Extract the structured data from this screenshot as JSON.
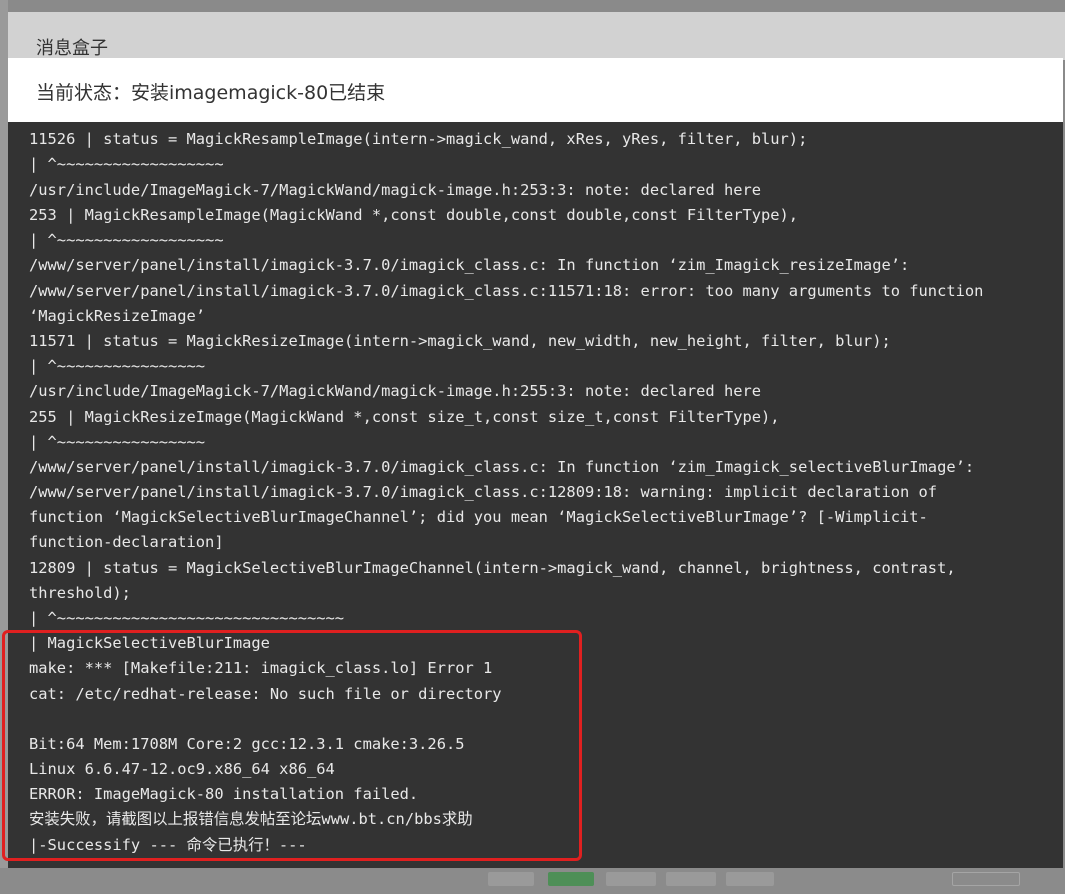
{
  "dialog": {
    "title": "消息盒子",
    "status": "当前状态：安装imagemagick-80已结束"
  },
  "log": {
    "lines": [
      "11526 | status = MagickResampleImage(intern->magick_wand, xRes, yRes, filter, blur);",
      "| ^~~~~~~~~~~~~~~~~~~",
      "/usr/include/ImageMagick-7/MagickWand/magick-image.h:253:3: note: declared here",
      "253 | MagickResampleImage(MagickWand *,const double,const double,const FilterType),",
      "| ^~~~~~~~~~~~~~~~~~~",
      "/www/server/panel/install/imagick-3.7.0/imagick_class.c: In function ‘zim_Imagick_resizeImage’:",
      "/www/server/panel/install/imagick-3.7.0/imagick_class.c:11571:18: error: too many arguments to function",
      "‘MagickResizeImage’",
      "11571 | status = MagickResizeImage(intern->magick_wand, new_width, new_height, filter, blur);",
      "| ^~~~~~~~~~~~~~~~~",
      "/usr/include/ImageMagick-7/MagickWand/magick-image.h:255:3: note: declared here",
      "255 | MagickResizeImage(MagickWand *,const size_t,const size_t,const FilterType),",
      "| ^~~~~~~~~~~~~~~~~",
      "/www/server/panel/install/imagick-3.7.0/imagick_class.c: In function ‘zim_Imagick_selectiveBlurImage’:",
      "/www/server/panel/install/imagick-3.7.0/imagick_class.c:12809:18: warning: implicit declaration of",
      "function ‘MagickSelectiveBlurImageChannel’; did you mean ‘MagickSelectiveBlurImage’? [-Wimplicit-",
      "function-declaration]",
      "12809 | status = MagickSelectiveBlurImageChannel(intern->magick_wand, channel, brightness, contrast,",
      "threshold);",
      "| ^~~~~~~~~~~~~~~~~~~~~~~~~~~~~~~~",
      "| MagickSelectiveBlurImage",
      "make: *** [Makefile:211: imagick_class.lo] Error 1",
      "cat: /etc/redhat-release: No such file or directory",
      "",
      "Bit:64 Mem:1708M Core:2 gcc:12.3.1 cmake:3.26.5",
      "Linux 6.6.47-12.oc9.x86_64 x86_64",
      "ERROR: ImageMagick-80 installation failed.",
      "安装失败，请截图以上报错信息发帖至论坛www.bt.cn/bbs求助",
      "|-Successify --- 命令已执行！---"
    ]
  },
  "colors": {
    "terminal_bg": "#333333",
    "terminal_fg": "#e8e8e8",
    "highlight": "#e02020"
  }
}
